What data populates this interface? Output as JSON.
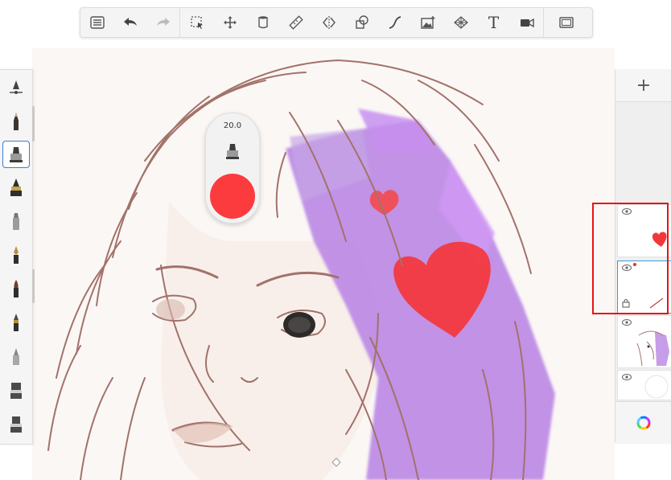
{
  "toolbar": {
    "items": [
      {
        "name": "list-icon"
      },
      {
        "name": "undo-icon"
      },
      {
        "name": "redo-icon"
      },
      {
        "name": "selection-icon"
      },
      {
        "name": "transform-icon"
      },
      {
        "name": "fill-icon"
      },
      {
        "name": "ruler-icon"
      },
      {
        "name": "symmetry-icon"
      },
      {
        "name": "shapes-icon"
      },
      {
        "name": "curve-icon"
      },
      {
        "name": "image-import-icon"
      },
      {
        "name": "perspective-guide-icon"
      },
      {
        "name": "text-icon",
        "label": "T"
      },
      {
        "name": "video-icon"
      },
      {
        "name": "fullscreen-icon"
      }
    ]
  },
  "brushes": {
    "items": [
      {
        "name": "brush-settings-icon"
      },
      {
        "name": "pencil-brush-icon"
      },
      {
        "name": "marker-brush-icon",
        "selected": true
      },
      {
        "name": "ink-brush-icon"
      },
      {
        "name": "airbrush-icon"
      },
      {
        "name": "fountain-pen-icon"
      },
      {
        "name": "paint-brush-icon"
      },
      {
        "name": "ballpoint-brush-icon"
      },
      {
        "name": "soft-brush-icon"
      },
      {
        "name": "fill-brush-icon"
      },
      {
        "name": "eraser-brush-icon"
      }
    ]
  },
  "puck": {
    "size_value": "20.0",
    "color": "#fc3b3e"
  },
  "layers": {
    "add_label": "+",
    "items": [
      {
        "name": "layer-hearts"
      },
      {
        "name": "layer-active",
        "selected": true
      },
      {
        "name": "layer-sketch"
      },
      {
        "name": "layer-background"
      }
    ]
  },
  "colors": {
    "accent": "#3a7bd5",
    "highlight": "#e81414",
    "purple_paint": "#b27fe0",
    "heart_red": "#f5363a",
    "sketch_line": "#a2726a"
  }
}
